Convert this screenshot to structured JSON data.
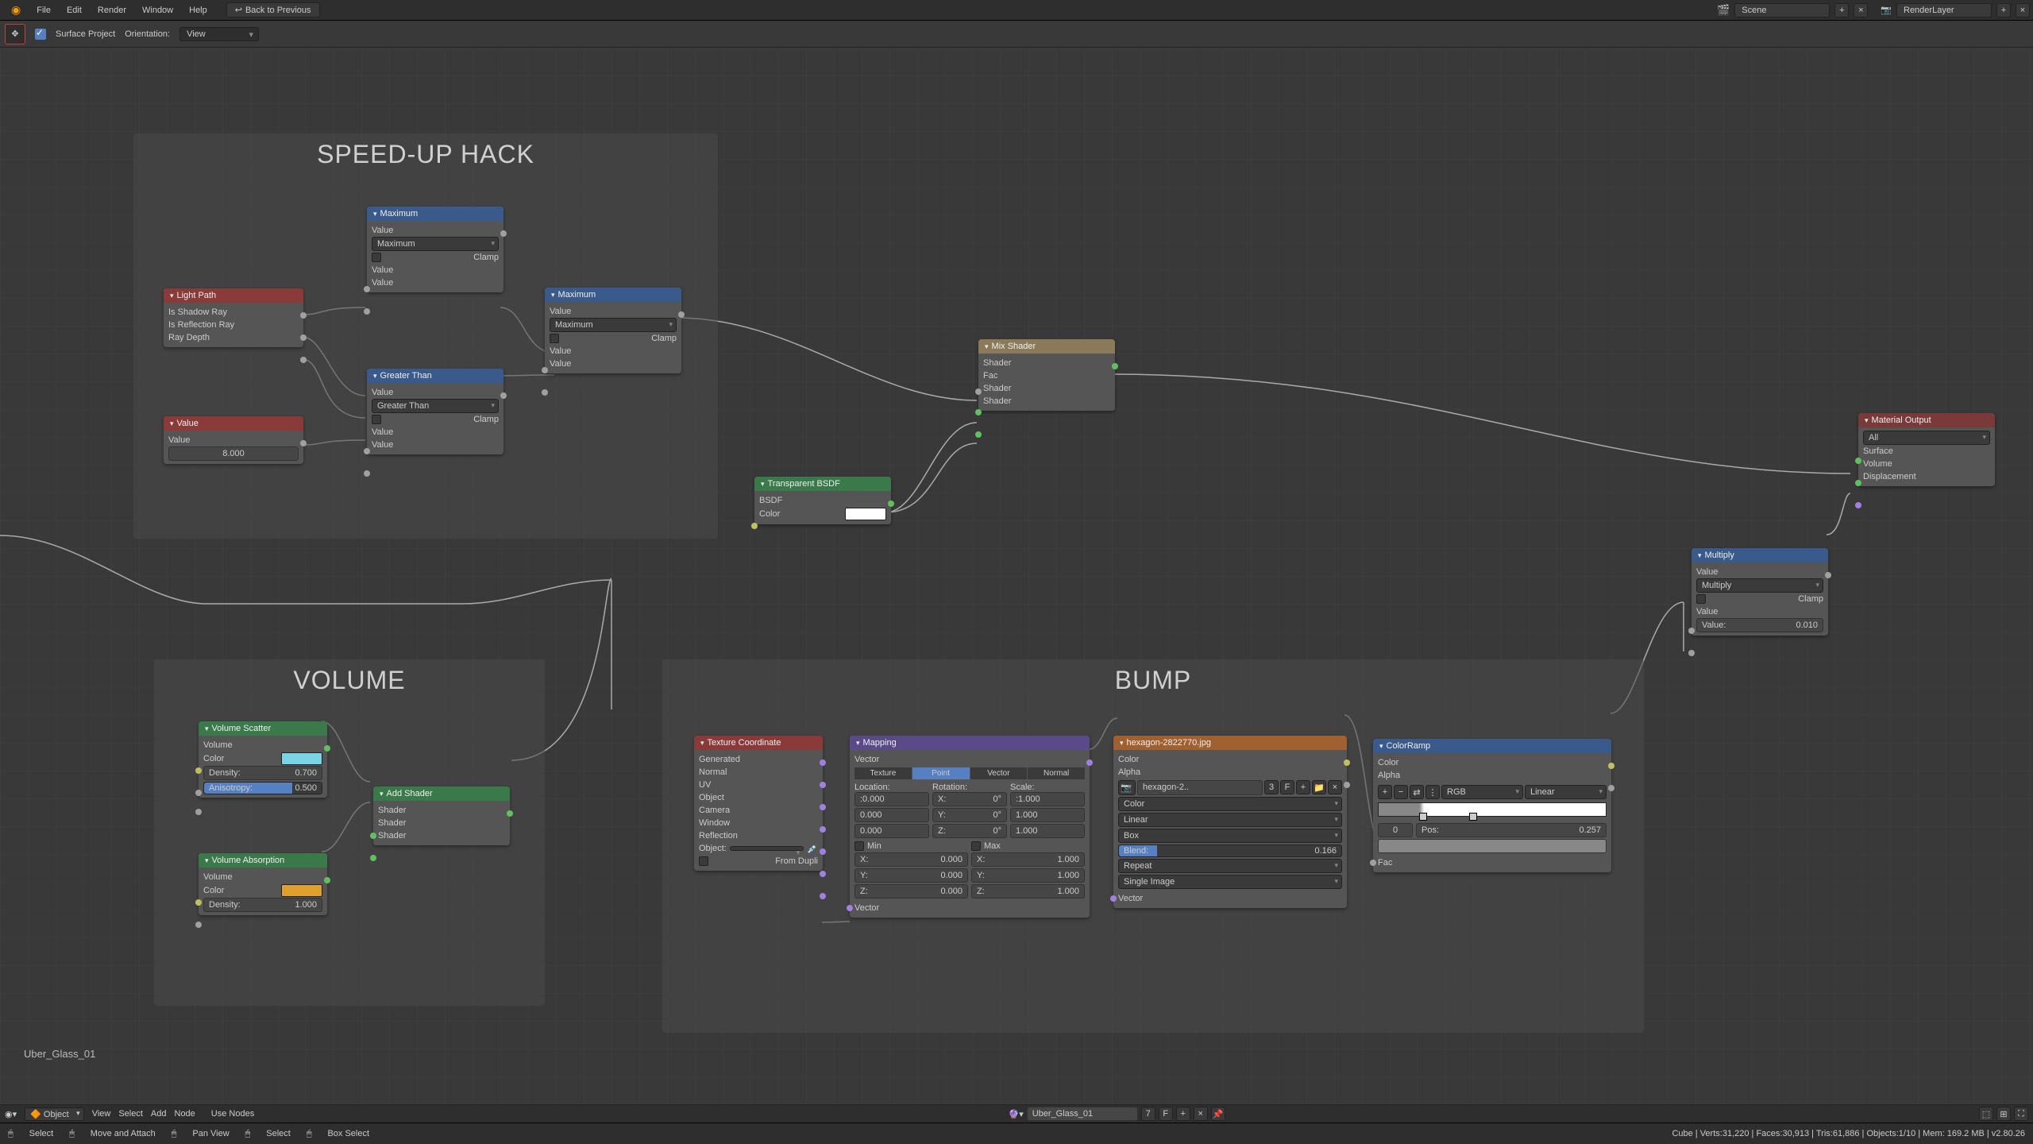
{
  "menubar": {
    "items": [
      "File",
      "Edit",
      "Render",
      "Window",
      "Help"
    ],
    "back": "Back to Previous",
    "scene_label": "Scene",
    "renderlayer_label": "RenderLayer"
  },
  "toolbar": {
    "surface_project": "Surface Project",
    "orientation": "Orientation:",
    "view": "View"
  },
  "frames": {
    "speedup": "SPEED-UP HACK",
    "volume": "VOLUME",
    "bump": "BUMP"
  },
  "nodes": {
    "lightpath": {
      "title": "Light Path",
      "o1": "Is Shadow Ray",
      "o2": "Is Reflection Ray",
      "o3": "Ray Depth"
    },
    "value": {
      "title": "Value",
      "out": "Value",
      "val": "8.000"
    },
    "max1": {
      "title": "Maximum",
      "mode": "Maximum",
      "clamp": "Clamp",
      "out": "Value",
      "in1": "Value",
      "in2": "Value"
    },
    "gt": {
      "title": "Greater Than",
      "mode": "Greater Than",
      "clamp": "Clamp",
      "out": "Value",
      "in1": "Value",
      "in2": "Value"
    },
    "max2": {
      "title": "Maximum",
      "mode": "Maximum",
      "clamp": "Clamp",
      "out": "Value",
      "in1": "Value",
      "in2": "Value"
    },
    "transp": {
      "title": "Transparent BSDF",
      "out": "BSDF",
      "color": "Color"
    },
    "mix": {
      "title": "Mix Shader",
      "out": "Shader",
      "fac": "Fac",
      "s1": "Shader",
      "s2": "Shader"
    },
    "multiply": {
      "title": "Multiply",
      "mode": "Multiply",
      "clamp": "Clamp",
      "out": "Value",
      "in1": "Value",
      "valuelabel": "Value:",
      "val": "0.010"
    },
    "matout": {
      "title": "Material Output",
      "all": "All",
      "surf": "Surface",
      "vol": "Volume",
      "disp": "Displacement"
    },
    "vscatter": {
      "title": "Volume Scatter",
      "out": "Volume",
      "color": "Color",
      "density": "Density:",
      "densval": "0.700",
      "aniso": "Anisotropy:",
      "anisoval": "0.500"
    },
    "vabsorb": {
      "title": "Volume Absorption",
      "out": "Volume",
      "color": "Color",
      "density": "Density:",
      "densval": "1.000"
    },
    "addshader": {
      "title": "Add Shader",
      "out": "Shader",
      "s1": "Shader",
      "s2": "Shader"
    },
    "texcoord": {
      "title": "Texture Coordinate",
      "o": [
        "Generated",
        "Normal",
        "UV",
        "Object",
        "Camera",
        "Window",
        "Reflection"
      ],
      "obj": "Object:",
      "fromdupli": "From Dupli"
    },
    "mapping": {
      "title": "Mapping",
      "out": "Vector",
      "tabs": [
        "Texture",
        "Point",
        "Vector",
        "Normal"
      ],
      "loc": "Location:",
      "rot": "Rotation:",
      "scale": "Scale:",
      "lx": ":0.000",
      "ly": "0.000",
      "lz": "0.000",
      "rx": "0°",
      "ry": "0°",
      "rz": "0°",
      "sx": ":1.000",
      "sy": "1.000",
      "sz": "1.000",
      "min": "Min",
      "max": "Max",
      "mx1": "0.000",
      "mx2": "1.000",
      "in": "Vector"
    },
    "image": {
      "title": "hexagon-2822770.jpg",
      "out1": "Color",
      "out2": "Alpha",
      "name": "hexagon-2..",
      "users": "3",
      "colorspace": "Color",
      "interp": "Linear",
      "proj": "Box",
      "blend": "Blend:",
      "blendval": "0.166",
      "ext": "Repeat",
      "src": "Single Image",
      "in": "Vector"
    },
    "colorramp": {
      "title": "ColorRamp",
      "out1": "Color",
      "out2": "Alpha",
      "rgb": "RGB",
      "linear": "Linear",
      "stopidx": "0",
      "pos": "Pos:",
      "posval": "0.257",
      "fac": "Fac"
    }
  },
  "material_name": "Uber_Glass_01",
  "bottom": {
    "mode": "Object",
    "view": "View",
    "select": "Select",
    "add": "Add",
    "node": "Node",
    "usenodes": "Use Nodes",
    "mat": "Uber_Glass_01",
    "users": "7",
    "f": "F"
  },
  "status": {
    "select": "Select",
    "moveattach": "Move and Attach",
    "panview": "Pan View",
    "select2": "Select",
    "boxselect": "Box Select",
    "info": "Cube | Verts:31,220 | Faces:30,913 | Tris:61,886 | Objects:1/10 | Mem: 169.2 MB | v2.80.26"
  }
}
